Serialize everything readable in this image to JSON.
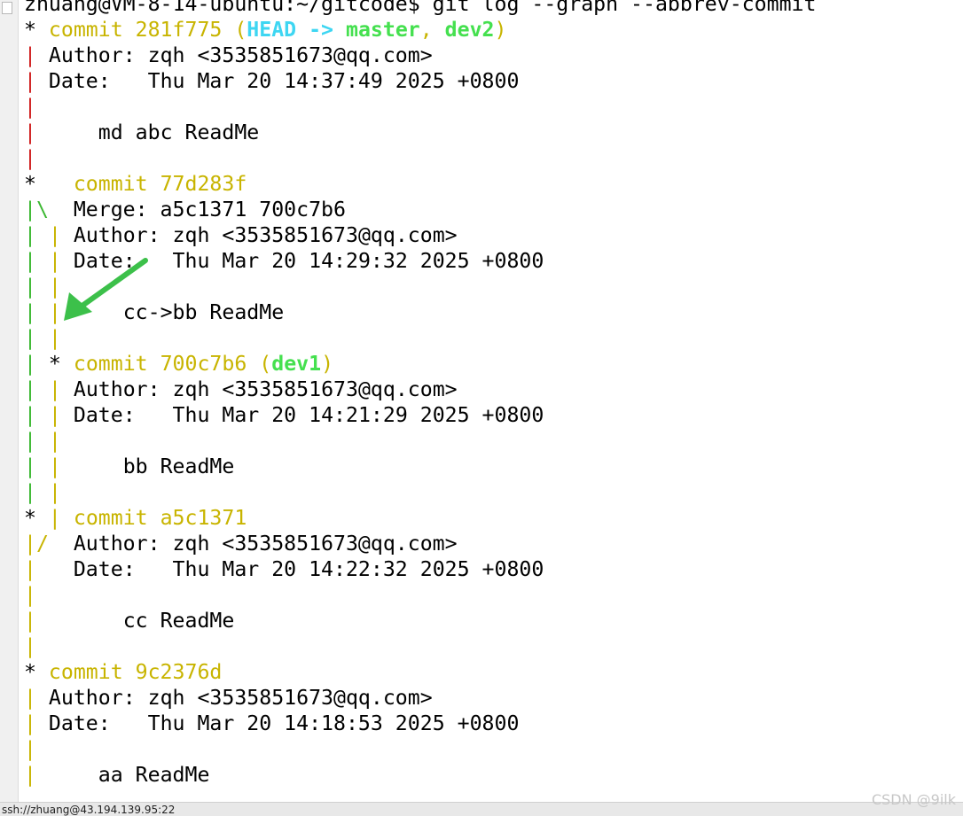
{
  "terminal": {
    "lines": [
      {
        "segs": [
          {
            "t": "zhuang@VM-8-14-ubuntu:~/gitcode$ git log --graph --abbrev-commit",
            "c": "#000000"
          }
        ]
      },
      {
        "segs": [
          {
            "t": "* ",
            "c": "#000000"
          },
          {
            "t": "commit 281f775 (",
            "c": "#c8b400"
          },
          {
            "t": "HEAD -> ",
            "c": "#3ed6f2",
            "b": true
          },
          {
            "t": "master",
            "c": "#45e04f",
            "b": true
          },
          {
            "t": ", ",
            "c": "#c8b400"
          },
          {
            "t": "dev2",
            "c": "#45e04f",
            "b": true
          },
          {
            "t": ")",
            "c": "#c8b400"
          }
        ]
      },
      {
        "segs": [
          {
            "t": "|",
            "c": "#d02020"
          },
          {
            "t": " Author: zqh <3535851673@qq.com>",
            "c": "#000000"
          }
        ]
      },
      {
        "segs": [
          {
            "t": "|",
            "c": "#d02020"
          },
          {
            "t": " Date:   Thu Mar 20 14:37:49 2025 +0800",
            "c": "#000000"
          }
        ]
      },
      {
        "segs": [
          {
            "t": "|",
            "c": "#d02020"
          }
        ]
      },
      {
        "segs": [
          {
            "t": "|",
            "c": "#d02020"
          },
          {
            "t": "     md abc ReadMe",
            "c": "#000000"
          }
        ]
      },
      {
        "segs": [
          {
            "t": "|",
            "c": "#d02020"
          }
        ]
      },
      {
        "segs": [
          {
            "t": "*   ",
            "c": "#000000"
          },
          {
            "t": "commit 77d283f",
            "c": "#c8b400"
          }
        ]
      },
      {
        "segs": [
          {
            "t": "|\\",
            "c": "#3cb832"
          },
          {
            "t": "  Merge: a5c1371 700c7b6",
            "c": "#000000"
          }
        ]
      },
      {
        "segs": [
          {
            "t": "|",
            "c": "#3cb832"
          },
          {
            "t": " ",
            "c": "#000000"
          },
          {
            "t": "|",
            "c": "#c8b400"
          },
          {
            "t": " Author: zqh <3535851673@qq.com>",
            "c": "#000000"
          }
        ]
      },
      {
        "segs": [
          {
            "t": "|",
            "c": "#3cb832"
          },
          {
            "t": " ",
            "c": "#000000"
          },
          {
            "t": "|",
            "c": "#c8b400"
          },
          {
            "t": " Date:   Thu Mar 20 14:29:32 2025 +0800",
            "c": "#000000"
          }
        ]
      },
      {
        "segs": [
          {
            "t": "|",
            "c": "#3cb832"
          },
          {
            "t": " ",
            "c": "#000000"
          },
          {
            "t": "|",
            "c": "#c8b400"
          }
        ]
      },
      {
        "segs": [
          {
            "t": "|",
            "c": "#3cb832"
          },
          {
            "t": " ",
            "c": "#000000"
          },
          {
            "t": "|",
            "c": "#c8b400"
          },
          {
            "t": "     cc->bb ReadMe",
            "c": "#000000"
          }
        ]
      },
      {
        "segs": [
          {
            "t": "|",
            "c": "#3cb832"
          },
          {
            "t": " ",
            "c": "#000000"
          },
          {
            "t": "|",
            "c": "#c8b400"
          }
        ]
      },
      {
        "segs": [
          {
            "t": "|",
            "c": "#3cb832"
          },
          {
            "t": " * ",
            "c": "#000000"
          },
          {
            "t": "commit 700c7b6 (",
            "c": "#c8b400"
          },
          {
            "t": "dev1",
            "c": "#45e04f",
            "b": true
          },
          {
            "t": ")",
            "c": "#c8b400"
          }
        ]
      },
      {
        "segs": [
          {
            "t": "|",
            "c": "#3cb832"
          },
          {
            "t": " ",
            "c": "#000000"
          },
          {
            "t": "|",
            "c": "#c8b400"
          },
          {
            "t": " Author: zqh <3535851673@qq.com>",
            "c": "#000000"
          }
        ]
      },
      {
        "segs": [
          {
            "t": "|",
            "c": "#3cb832"
          },
          {
            "t": " ",
            "c": "#000000"
          },
          {
            "t": "|",
            "c": "#c8b400"
          },
          {
            "t": " Date:   Thu Mar 20 14:21:29 2025 +0800",
            "c": "#000000"
          }
        ]
      },
      {
        "segs": [
          {
            "t": "|",
            "c": "#3cb832"
          },
          {
            "t": " ",
            "c": "#000000"
          },
          {
            "t": "|",
            "c": "#c8b400"
          }
        ]
      },
      {
        "segs": [
          {
            "t": "|",
            "c": "#3cb832"
          },
          {
            "t": " ",
            "c": "#000000"
          },
          {
            "t": "|",
            "c": "#c8b400"
          },
          {
            "t": "     bb ReadMe",
            "c": "#000000"
          }
        ]
      },
      {
        "segs": [
          {
            "t": "|",
            "c": "#3cb832"
          },
          {
            "t": " ",
            "c": "#000000"
          },
          {
            "t": "|",
            "c": "#c8b400"
          }
        ]
      },
      {
        "segs": [
          {
            "t": "* ",
            "c": "#000000"
          },
          {
            "t": "|",
            "c": "#c8b400"
          },
          {
            "t": " ",
            "c": "#000000"
          },
          {
            "t": "commit a5c1371",
            "c": "#c8b400"
          }
        ]
      },
      {
        "segs": [
          {
            "t": "|/",
            "c": "#c8b400"
          },
          {
            "t": "  Author: zqh <3535851673@qq.com>",
            "c": "#000000"
          }
        ]
      },
      {
        "segs": [
          {
            "t": "|",
            "c": "#c8b400"
          },
          {
            "t": "   Date:   Thu Mar 20 14:22:32 2025 +0800",
            "c": "#000000"
          }
        ]
      },
      {
        "segs": [
          {
            "t": "|",
            "c": "#c8b400"
          }
        ]
      },
      {
        "segs": [
          {
            "t": "|",
            "c": "#c8b400"
          },
          {
            "t": "       cc ReadMe",
            "c": "#000000"
          }
        ]
      },
      {
        "segs": [
          {
            "t": "|",
            "c": "#c8b400"
          }
        ]
      },
      {
        "segs": [
          {
            "t": "* ",
            "c": "#000000"
          },
          {
            "t": "commit 9c2376d",
            "c": "#c8b400"
          }
        ]
      },
      {
        "segs": [
          {
            "t": "|",
            "c": "#c8b400"
          },
          {
            "t": " Author: zqh <3535851673@qq.com>",
            "c": "#000000"
          }
        ]
      },
      {
        "segs": [
          {
            "t": "|",
            "c": "#c8b400"
          },
          {
            "t": " Date:   Thu Mar 20 14:18:53 2025 +0800",
            "c": "#000000"
          }
        ]
      },
      {
        "segs": [
          {
            "t": "|",
            "c": "#c8b400"
          }
        ]
      },
      {
        "segs": [
          {
            "t": "|",
            "c": "#c8b400"
          },
          {
            "t": "     aa ReadMe",
            "c": "#000000"
          }
        ]
      }
    ]
  },
  "annotation": {
    "icon": "arrow-icon",
    "color": "#3cc04a"
  },
  "status_bar": {
    "text": "ssh://zhuang@43.194.139.95:22"
  },
  "watermark": {
    "text": "CSDN @9ilk"
  }
}
